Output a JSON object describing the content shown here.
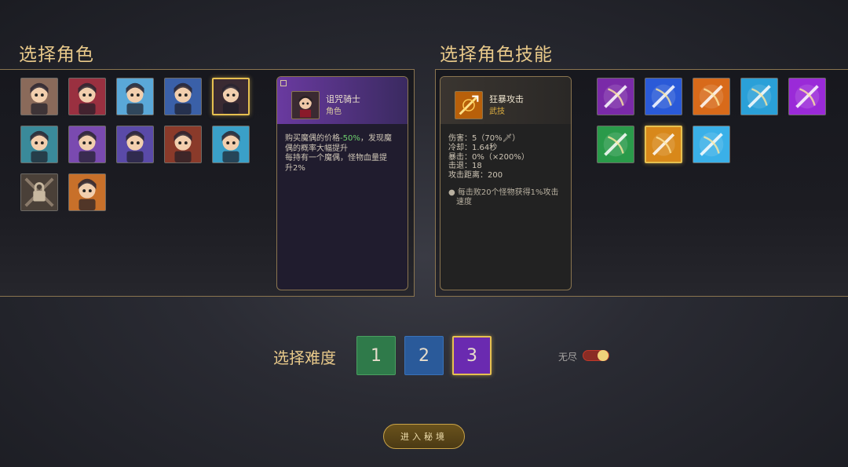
{
  "left_section": {
    "title": "选择角色"
  },
  "right_section": {
    "title": "选择角色技能"
  },
  "characters": [
    {
      "icon": "scientist-glasses-icon",
      "color": "#8a6a5a",
      "selected": false
    },
    {
      "icon": "red-robot-icon",
      "color": "#9a3040",
      "selected": false
    },
    {
      "icon": "ice-mech-icon",
      "color": "#5aa8d8",
      "selected": false
    },
    {
      "icon": "blue-robot-icon",
      "color": "#3a60a8",
      "selected": false
    },
    {
      "icon": "cursed-knight-icon",
      "color": "#3a2a32",
      "selected": true
    },
    {
      "icon": "witch-hat-icon",
      "color": "#3a8a9a",
      "selected": false
    },
    {
      "icon": "white-hair-hero-icon",
      "color": "#7a4ab0",
      "selected": false
    },
    {
      "icon": "purple-mage-icon",
      "color": "#5a4aa8",
      "selected": false
    },
    {
      "icon": "horned-warrior-icon",
      "color": "#8a3a2a",
      "selected": false
    },
    {
      "icon": "blue-hair-girl-icon",
      "color": "#3aa0c8",
      "selected": false
    },
    {
      "icon": "locked-character-icon",
      "color": "#5a4a40",
      "selected": false
    },
    {
      "icon": "goggles-girl-icon",
      "color": "#c8702a",
      "selected": false
    }
  ],
  "character_card": {
    "name": "诅咒骑士",
    "type": "角色",
    "desc_prefix": "购买魔偶的价格",
    "desc_value": "-50%",
    "desc_suffix": "，发现魔",
    "lines": [
      "偶的概率大幅提升",
      "每持有一个魔偶，怪物血量提",
      "升2%"
    ]
  },
  "skills": [
    {
      "icon": "purple-slash-icon",
      "color": "#7a2aa8",
      "selected": false
    },
    {
      "icon": "blue-sword-icon",
      "color": "#2a5ad8",
      "selected": false
    },
    {
      "icon": "fire-blade-icon",
      "color": "#d86a1a",
      "selected": false
    },
    {
      "icon": "water-wave-icon",
      "color": "#2aa0d8",
      "selected": false
    },
    {
      "icon": "purple-shuriken-icon",
      "color": "#9a2ad8",
      "selected": false
    },
    {
      "icon": "green-arrows-icon",
      "color": "#2a9a4a",
      "selected": false
    },
    {
      "icon": "berserk-strike-icon",
      "color": "#d8881a",
      "selected": true
    },
    {
      "icon": "ice-wolf-icon",
      "color": "#3ab0e8",
      "selected": false
    }
  ],
  "skill_card": {
    "name": "狂暴攻击",
    "type": "武技",
    "stats": [
      "伤害：5（70%🗡）",
      "冷却：1.64秒",
      "暴击：0%（×200%）",
      "击退：18",
      "攻击距离：200"
    ],
    "note_lines": [
      "● 每击败20个怪物获得1%攻击",
      "速度"
    ]
  },
  "difficulty": {
    "label": "选择难度",
    "options": [
      {
        "value": "1",
        "color": "#2f7a4a",
        "border": "#4aa060",
        "selected": false
      },
      {
        "value": "2",
        "color": "#2a5a9a",
        "border": "#3a72b8",
        "selected": false
      },
      {
        "value": "3",
        "color": "#6a2ab0",
        "border": "#e6c050",
        "selected": true
      }
    ]
  },
  "endless": {
    "label": "无尽",
    "enabled": true
  },
  "enter_button": {
    "label": "进入秘境"
  }
}
